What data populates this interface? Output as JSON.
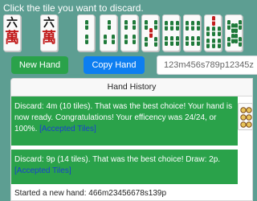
{
  "instruction": "Click the tile you want to discard.",
  "hand_tiles": [
    {
      "suit": "man",
      "rank": 6,
      "glyph_top": "六",
      "glyph_bottom": "萬"
    },
    {
      "suit": "man",
      "rank": 6,
      "glyph_top": "六",
      "glyph_bottom": "萬"
    },
    {
      "suit": "sou",
      "rank": 2
    },
    {
      "suit": "sou",
      "rank": 3
    },
    {
      "suit": "sou",
      "rank": 4
    },
    {
      "suit": "sou",
      "rank": 5
    },
    {
      "suit": "sou",
      "rank": 6
    },
    {
      "suit": "sou",
      "rank": 6
    },
    {
      "suit": "sou",
      "rank": 7
    },
    {
      "suit": "sou",
      "rank": 8
    }
  ],
  "buttons": {
    "new_hand": "New Hand",
    "copy_hand": "Copy Hand"
  },
  "hand_input": {
    "value": "123m456s789p12345z"
  },
  "history": {
    "title": "Hand History",
    "entries": [
      {
        "type": "success",
        "text": "Discard: 4m (10 tiles). That was the best choice! Your hand is now ready. Congratulations! Your efficency was 24/24, or 100%.",
        "link": "[Accepted Tiles]"
      },
      {
        "type": "success",
        "text": "Discard: 9p (14 tiles). That was the best choice! Draw: 2p.",
        "link": "[Accepted Tiles]"
      },
      {
        "type": "plain",
        "text": "Started a new hand: 466m23456678s139p"
      }
    ]
  },
  "colors": {
    "background": "#5d9e92",
    "success": "#2aa24a",
    "primary": "#0d7ef0",
    "man_red": "#c21d1d",
    "sou_green": "#1f7a3a",
    "link": "#1b3fd0"
  }
}
